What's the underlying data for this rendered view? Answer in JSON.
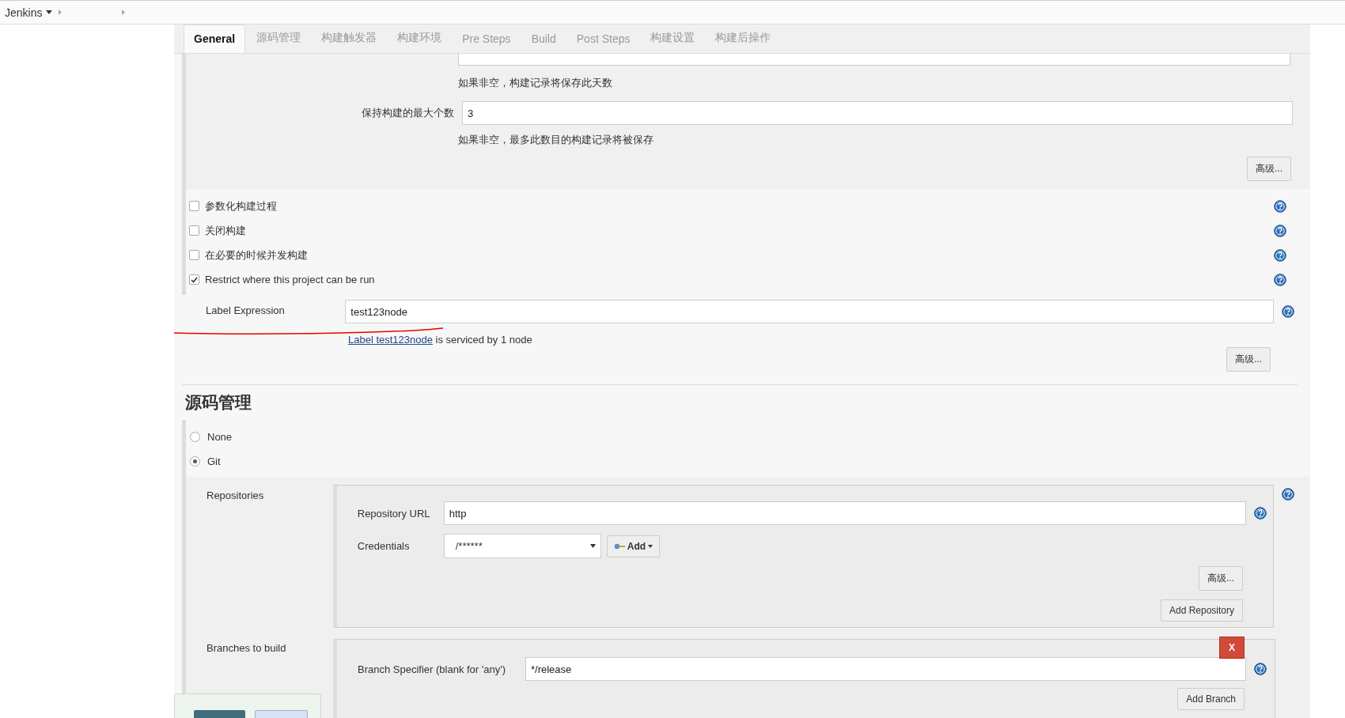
{
  "breadcrumb": {
    "root": "Jenkins"
  },
  "tabs": [
    {
      "label": "General",
      "selected": true
    },
    {
      "label": "源码管理",
      "selected": false
    },
    {
      "label": "构建触发器",
      "selected": false
    },
    {
      "label": "构建环境",
      "selected": false
    },
    {
      "label": "Pre Steps",
      "selected": false
    },
    {
      "label": "Build",
      "selected": false
    },
    {
      "label": "Post Steps",
      "selected": false
    },
    {
      "label": "构建设置",
      "selected": false
    },
    {
      "label": "构建后操作",
      "selected": false
    }
  ],
  "discard": {
    "days_hint": "如果非空，构建记录将保存此天数",
    "max_builds_label": "保持构建的最大个数",
    "max_builds_value": "3",
    "max_hint": "如果非空，最多此数目的构建记录将被保存",
    "advanced": "高级..."
  },
  "options": [
    {
      "label": "参数化构建过程",
      "checked": false
    },
    {
      "label": "关闭构建",
      "checked": false
    },
    {
      "label": "在必要的时候并发构建",
      "checked": false
    },
    {
      "label": "Restrict where this project can be run",
      "checked": true
    }
  ],
  "label_expression": {
    "label": "Label Expression",
    "value": "test123node",
    "link": "Label test123node",
    "note": "is serviced by 1 node",
    "advanced": "高级..."
  },
  "scm": {
    "heading": "源码管理",
    "choices": [
      {
        "label": "None",
        "selected": false
      },
      {
        "label": "Git",
        "selected": true
      }
    ],
    "repositories_label": "Repositories",
    "url_label": "Repository URL",
    "url_value": "http",
    "credentials_label": "Credentials",
    "credentials_value": "/******",
    "add": "Add",
    "advanced": "高级...",
    "add_repository": "Add Repository",
    "branches_label": "Branches to build",
    "delete": "X",
    "branch_label": "Branch Specifier (blank for 'any')",
    "branch_value": "*/release",
    "add_branch": "Add Branch"
  }
}
